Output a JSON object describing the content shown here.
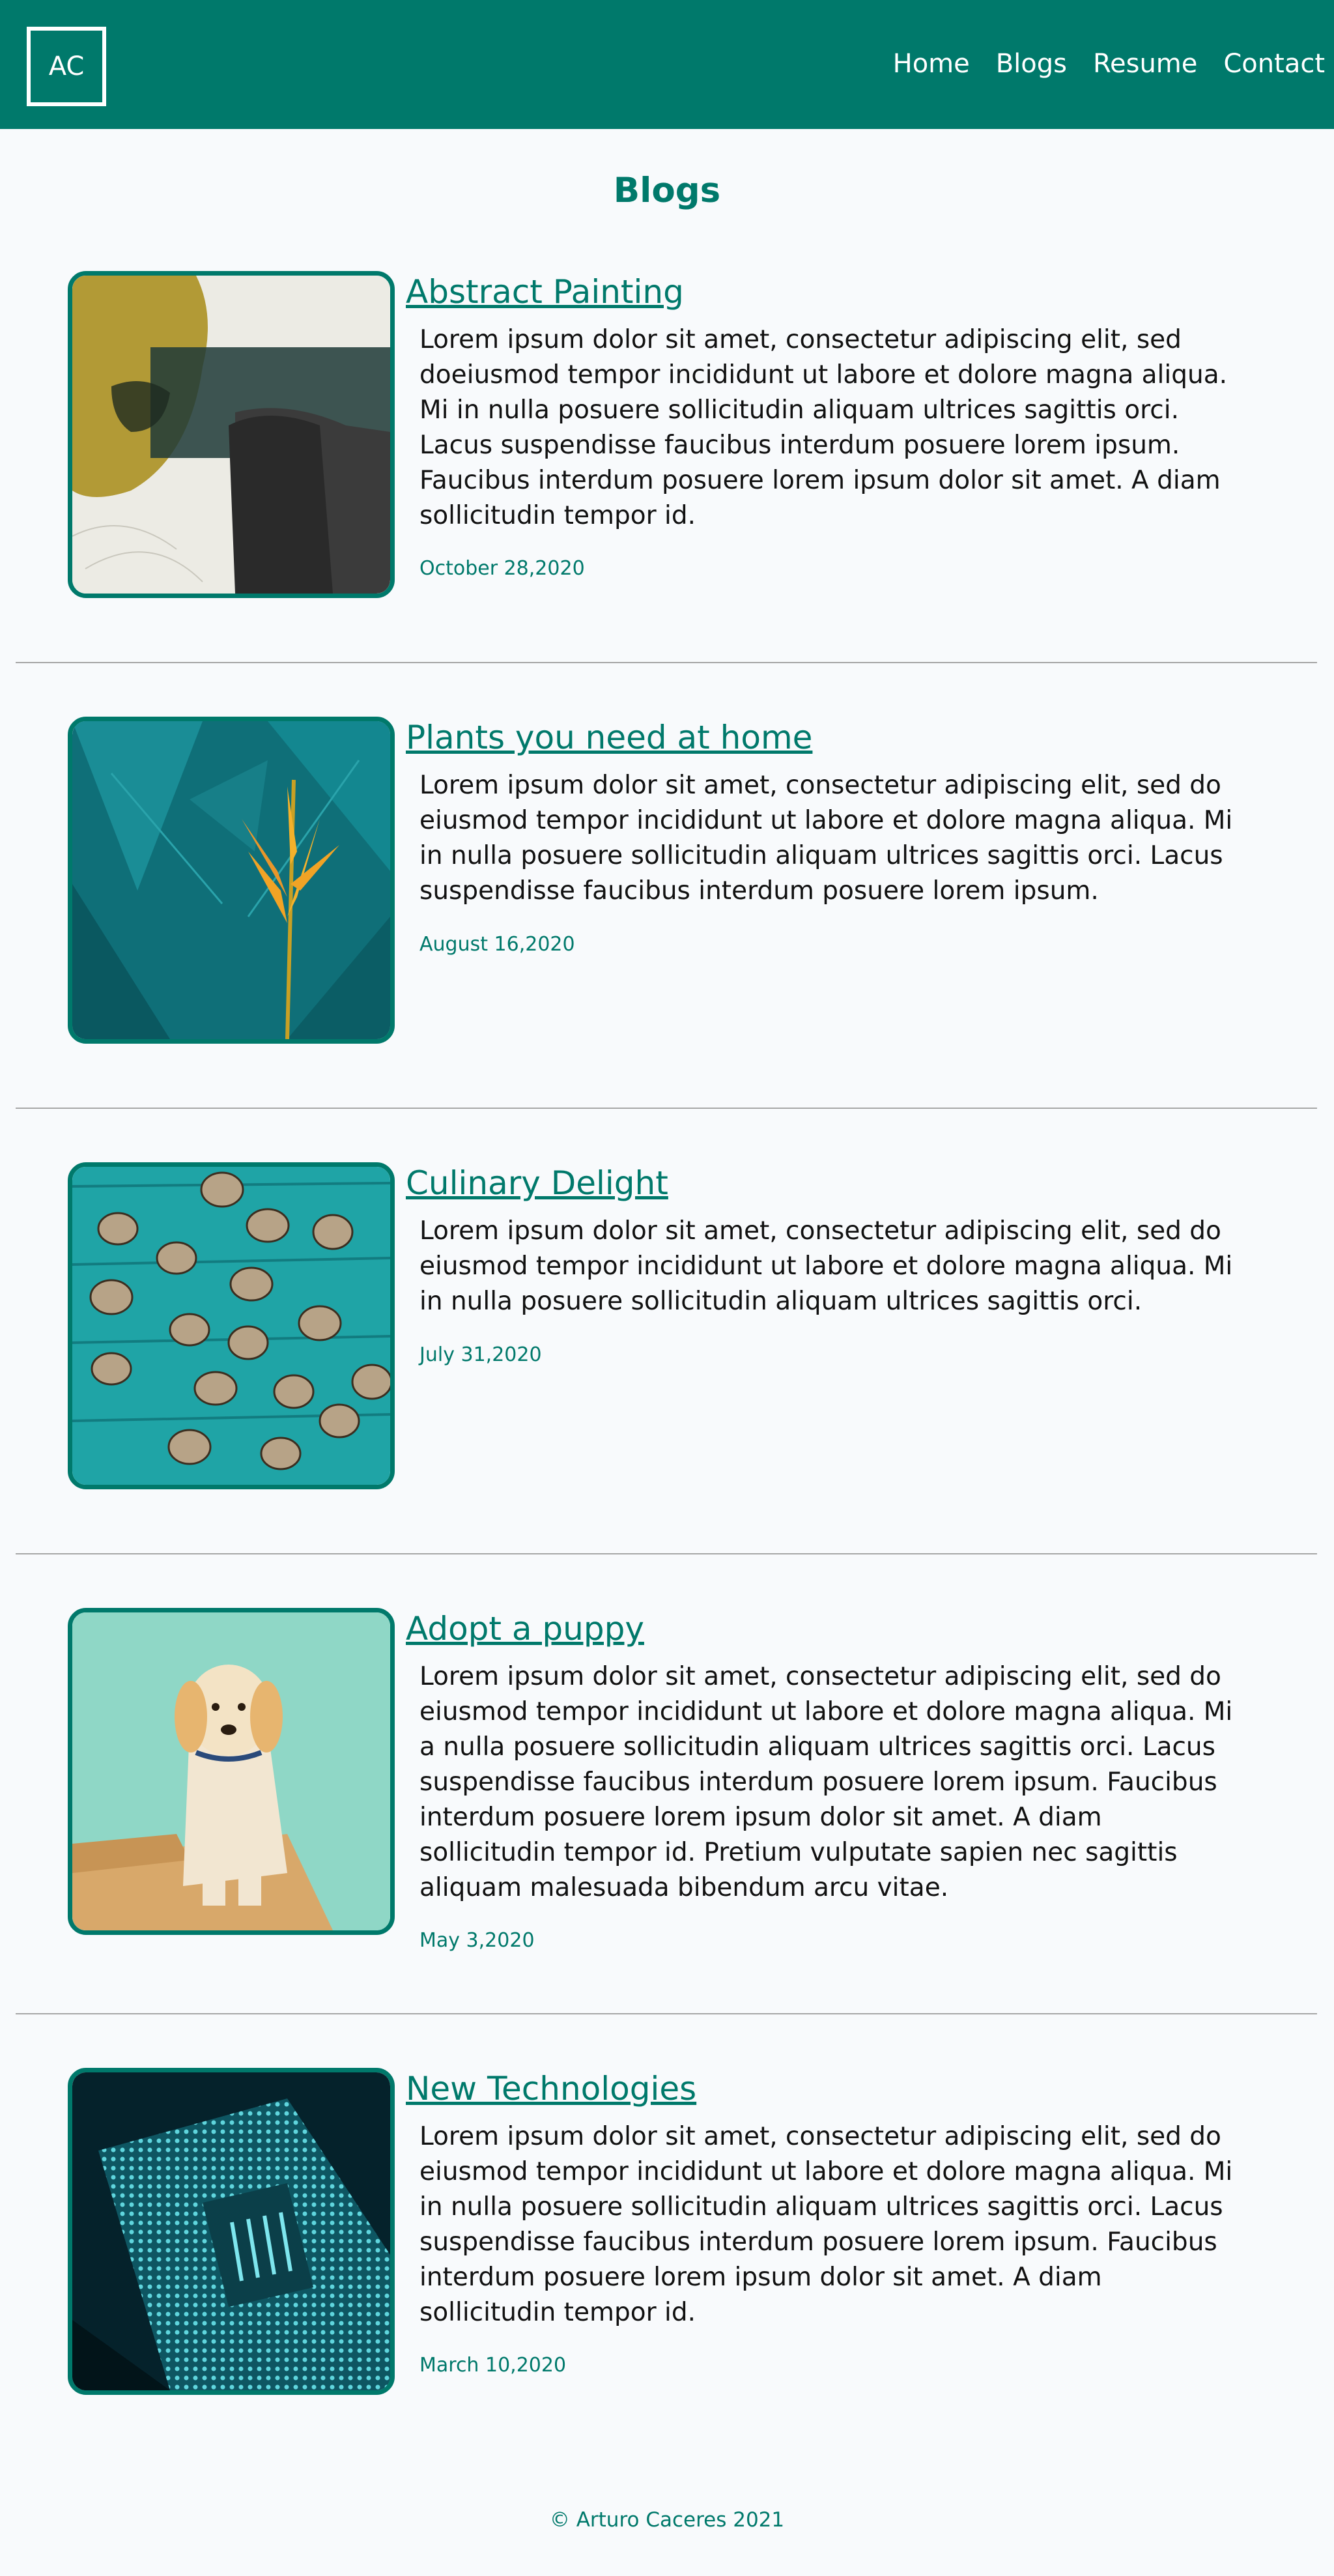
{
  "header": {
    "logo": "AC",
    "nav": [
      "Home",
      "Blogs",
      "Resume",
      "Contact"
    ],
    "color": "#00796b"
  },
  "page_title": "Blogs",
  "posts": [
    {
      "title": "Abstract Painting",
      "body": "Lorem ipsum dolor sit amet, consectetur adipiscing elit, sed doeiusmod tempor incididunt ut labore et dolore magna aliqua. Mi in nulla posuere sollicitudin aliquam ultrices sagittis orci. Lacus suspendisse faucibus interdum posuere lorem ipsum. Faucibus interdum posuere lorem ipsum dolor sit amet. A diam sollicitudin tempor id.",
      "date": "October 28,2020",
      "image": "abstract-painting-image"
    },
    {
      "title": "Plants you need at home",
      "body": "Lorem ipsum dolor sit amet, consectetur adipiscing elit, sed do eiusmod tempor incididunt ut labore et dolore magna aliqua. Mi in nulla posuere sollicitudin aliquam ultrices sagittis orci. Lacus suspendisse faucibus interdum posuere lorem ipsum.",
      "date": "August 16,2020",
      "image": "tropical-plant-image"
    },
    {
      "title": "Culinary Delight",
      "body": "Lorem ipsum dolor sit amet, consectetur adipiscing elit, sed do eiusmod tempor incididunt ut labore et dolore magna aliqua. Mi in nulla posuere sollicitudin aliquam ultrices sagittis orci.",
      "date": "July 31,2020",
      "image": "quail-eggs-image"
    },
    {
      "title": "Adopt a puppy",
      "body": "Lorem ipsum dolor sit amet, consectetur adipiscing elit, sed do eiusmod tempor incididunt ut labore et dolore magna aliqua. Mi a nulla posuere sollicitudin aliquam ultrices sagittis orci. Lacus suspendisse faucibus interdum posuere lorem ipsum. Faucibus interdum posuere lorem ipsum dolor sit amet. A diam sollicitudin tempor id. Pretium vulputate sapien nec sagittis aliquam malesuada bibendum arcu vitae.",
      "date": "May 3,2020",
      "image": "puppy-image"
    },
    {
      "title": "New Technologies",
      "body": "Lorem ipsum dolor sit amet, consectetur adipiscing elit, sed do eiusmod tempor incididunt ut labore et dolore magna aliqua. Mi in nulla posuere sollicitudin aliquam ultrices sagittis orci. Lacus suspendisse faucibus interdum posuere lorem ipsum. Faucibus interdum posuere lorem ipsum dolor sit amet. A diam sollicitudin tempor id.",
      "date": "March 10,2020",
      "image": "cpu-chip-image"
    }
  ],
  "footer": "© Arturo Caceres 2021"
}
